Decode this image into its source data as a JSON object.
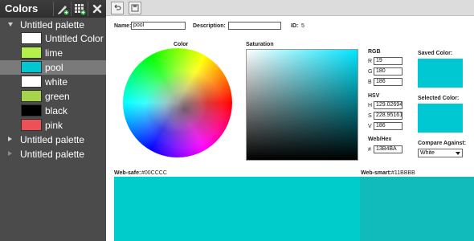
{
  "sidebar": {
    "title": "Colors",
    "tools": [
      {
        "icon": "brush-add-icon"
      },
      {
        "icon": "grid-add-icon"
      },
      {
        "icon": "close-icon"
      }
    ],
    "palettes": [
      {
        "name": "Untitled palette",
        "expanded": true,
        "colors": [
          {
            "name": "Untitled Color",
            "hex": "#ffffff",
            "selected": false
          },
          {
            "name": "lime",
            "hex": "#b4f04a",
            "selected": false
          },
          {
            "name": "pool",
            "hex": "#00c8d2",
            "selected": true
          },
          {
            "name": "white",
            "hex": "#ffffff",
            "selected": false
          },
          {
            "name": "green",
            "hex": "#a6d44a",
            "selected": false
          },
          {
            "name": "black",
            "hex": "#000000",
            "selected": false
          },
          {
            "name": "pink",
            "hex": "#ef4f56",
            "selected": false
          }
        ]
      },
      {
        "name": "Untitled palette",
        "expanded": false
      },
      {
        "name": "Untitled palette",
        "expanded": false
      }
    ]
  },
  "toolbar": {
    "undo_icon": "undo-icon",
    "save_icon": "save-icon"
  },
  "editor": {
    "name_label": "Name:",
    "name_value": "pool",
    "description_label": "Description:",
    "description_value": "",
    "id_label": "ID:",
    "id_value": "5",
    "color_label": "Color",
    "saturation_label": "Saturation",
    "rgb": {
      "label": "RGB",
      "r_label": "R",
      "r": "19",
      "g_label": "G",
      "g": "180",
      "b_label": "B",
      "b": "186"
    },
    "hsv": {
      "label": "HSV",
      "h_label": "H",
      "h": "129.026946",
      "s_label": "S",
      "s": "228.951612",
      "v_label": "V",
      "v": "186"
    },
    "webhex": {
      "label": "Web/Hex",
      "hash": "#",
      "value": "13B4BA"
    },
    "saved_color_label": "Saved Color:",
    "selected_color_label": "Selected Color:",
    "compare_label": "Compare Against:",
    "compare_value": "White",
    "websafe_label": "Web-safe:",
    "websafe_value": "#00CCCC",
    "websmart_label": "Web-smart:",
    "websmart_value": "#11BBBB"
  },
  "colors": {
    "sidebar_bg": "#4b4b4b",
    "selected_row": "#7a7a7a",
    "current_color": "#00c8d2",
    "websafe": "#00cccc",
    "websmart": "#11bbbb"
  }
}
